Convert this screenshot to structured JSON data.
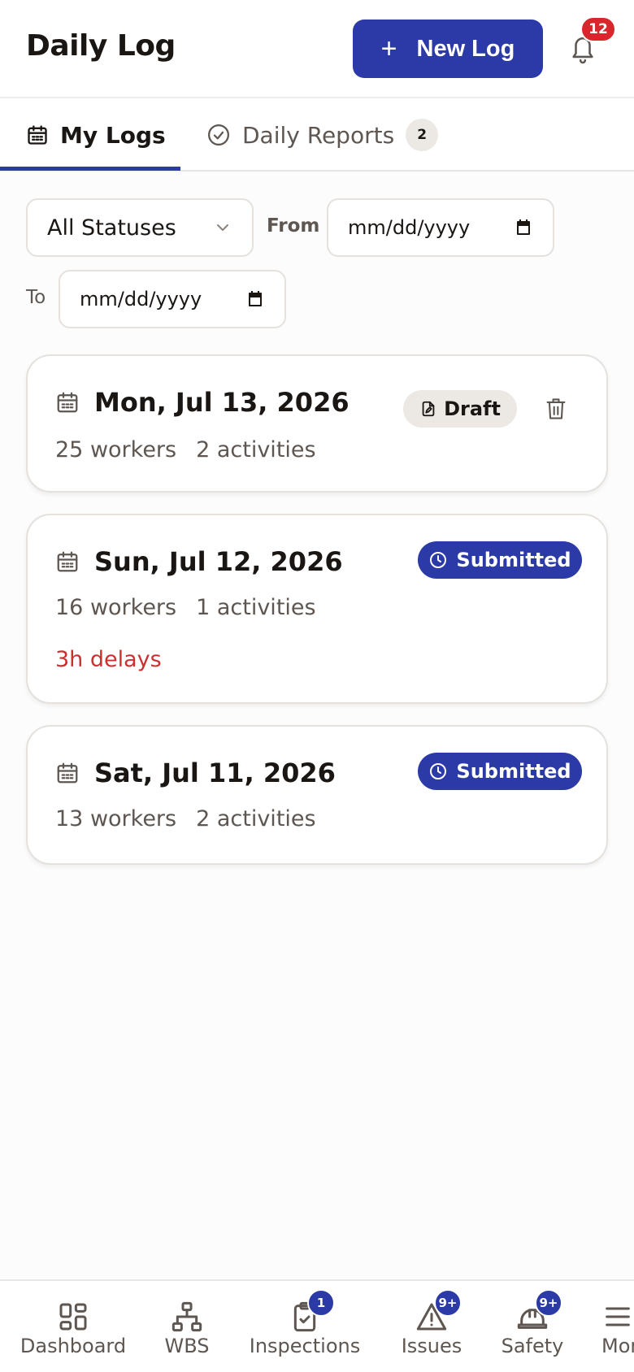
{
  "header": {
    "title": "Daily Log",
    "new_button_label": "New Log",
    "notification_count": "12"
  },
  "tabs": [
    {
      "label": "My Logs",
      "active": true
    },
    {
      "label": "Daily Reports",
      "count": "2"
    }
  ],
  "filters": {
    "status_value": "All Statuses",
    "from_label": "From",
    "from_placeholder": "mm/dd/yyyy",
    "to_label": "To",
    "to_placeholder": "mm/dd/yyyy"
  },
  "logs": [
    {
      "date": "Mon, Jul 13, 2026",
      "workers": "25 workers",
      "activities": "2 activities",
      "status": "Draft"
    },
    {
      "date": "Sun, Jul 12, 2026",
      "workers": "16 workers",
      "activities": "1 activities",
      "status": "Submitted",
      "delays": "3h delays"
    },
    {
      "date": "Sat, Jul 11, 2026",
      "workers": "13 workers",
      "activities": "2 activities",
      "status": "Submitted"
    }
  ],
  "bottom_nav": [
    {
      "label": "Dashboard",
      "icon": "dashboard-icon"
    },
    {
      "label": "WBS",
      "icon": "hierarchy-icon"
    },
    {
      "label": "Inspections",
      "icon": "clipboard-check-icon",
      "badge": "1"
    },
    {
      "label": "Issues",
      "icon": "warning-icon",
      "badge": "9+"
    },
    {
      "label": "Safety",
      "icon": "hardhat-icon",
      "badge": "9+"
    },
    {
      "label": "More",
      "icon": "menu-icon"
    }
  ],
  "colors": {
    "primary": "#2b3aa6",
    "danger": "#cc2f2f",
    "badge_red": "#d8262c",
    "muted_text": "#5e5651"
  }
}
